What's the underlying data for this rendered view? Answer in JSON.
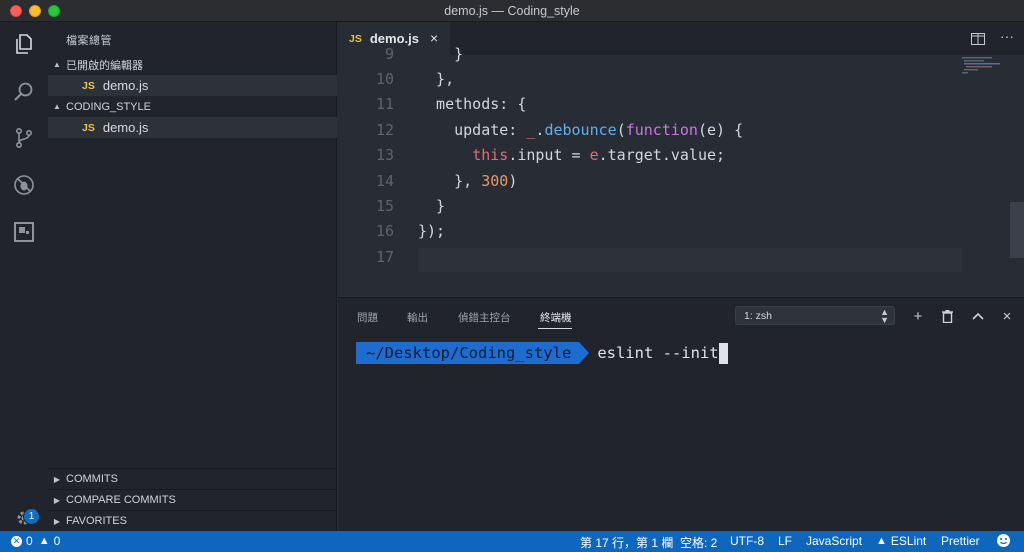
{
  "window": {
    "title": "demo.js — Coding_style"
  },
  "activity": {
    "icons": [
      "explorer-icon",
      "search-icon",
      "source-control-icon",
      "debug-icon",
      "extensions-icon",
      "gear-icon"
    ],
    "badge": "1"
  },
  "sidebar": {
    "title": "檔案總管",
    "open_editors": {
      "label": "已開啟的編輯器",
      "file_badge": "JS",
      "file": "demo.js"
    },
    "project": {
      "label": "CODING_STYLE",
      "file_badge": "JS",
      "file": "demo.js"
    },
    "bottom_sections": [
      "COMMITS",
      "COMPARE COMMITS",
      "FAVORITES"
    ]
  },
  "editor": {
    "tab": {
      "badge": "JS",
      "label": "demo.js",
      "close": "×"
    },
    "actions": {
      "split": "▯",
      "more": "···"
    },
    "line_numbers": [
      "9",
      "10",
      "11",
      "12",
      "13",
      "14",
      "15",
      "16",
      "17"
    ],
    "lines": [
      {
        "t": "    }"
      },
      {
        "t": "  },"
      },
      {
        "a": "  methods: {"
      },
      {
        "p1": "    update: ",
        "p2": "_",
        "p3": ".",
        "p4": "debounce",
        "p5": "(",
        "p6": "function",
        "p7": "(e) {"
      },
      {
        "q1": "      ",
        "q2": "this",
        "q3": ".input = ",
        "q4": "e",
        "q5": ".target.value;"
      },
      {
        "r1": "    }, ",
        "r2": "300",
        "r3": ")"
      },
      {
        "t": "  }"
      },
      {
        "t": "});"
      },
      {
        "t": ""
      }
    ]
  },
  "panel": {
    "tabs": [
      "問題",
      "輸出",
      "偵錯主控台",
      "終端機"
    ],
    "terminal_select": "1: zsh",
    "icons": {
      "add": "+",
      "trash": "🗑",
      "up": "⌃",
      "close": "×"
    },
    "prompt_path": "~/Desktop/Coding_style",
    "command": "eslint --init"
  },
  "status": {
    "errors": "0",
    "warnings": "0",
    "position": "第 17 行，第 1 欄",
    "indent": "空格: 2",
    "encoding": "UTF-8",
    "eol": "LF",
    "language": "JavaScript",
    "eslint": "ESLint",
    "prettier": "Prettier",
    "colors": {
      "status_bg": "#0f67bd",
      "accent": "#1d6cd0"
    }
  }
}
